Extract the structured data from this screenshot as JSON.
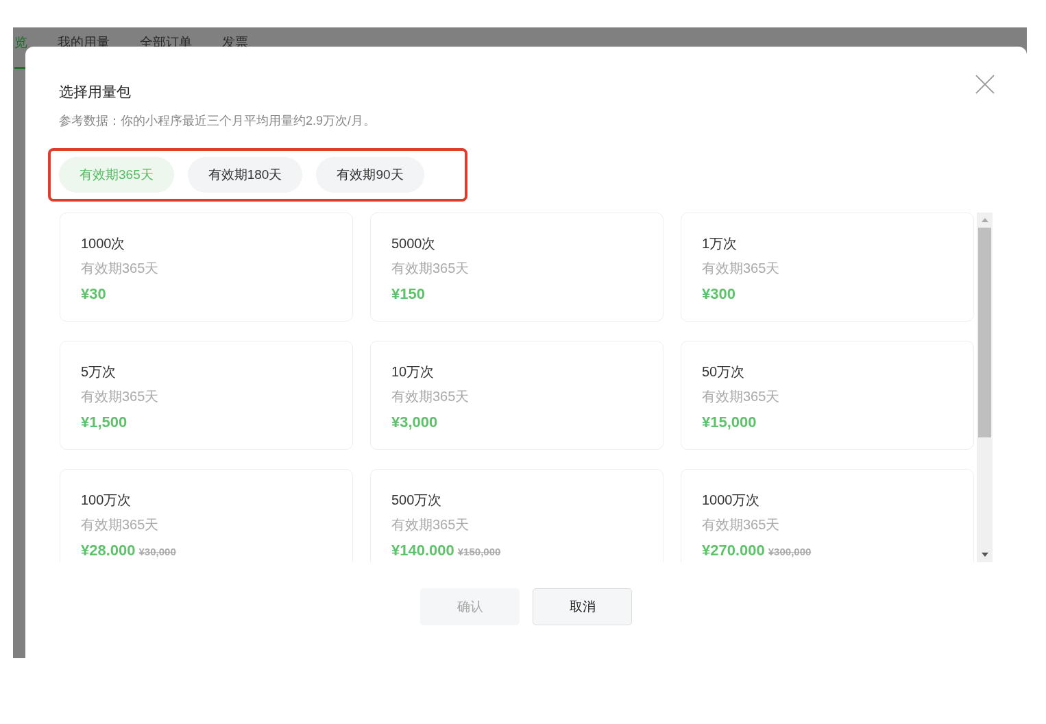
{
  "background_tabs": [
    {
      "label": "览",
      "selected": true
    },
    {
      "label": "我的用量",
      "selected": false
    },
    {
      "label": "全部订单",
      "selected": false
    },
    {
      "label": "发票",
      "selected": false
    }
  ],
  "dialog": {
    "title": "选择用量包",
    "subtitle": "参考数据：你的小程序最近三个月平均用量约2.9万次/月。",
    "period_options": [
      {
        "label": "有效期365天",
        "selected": true
      },
      {
        "label": "有效期180天",
        "selected": false
      },
      {
        "label": "有效期90天",
        "selected": false
      }
    ],
    "packages": [
      {
        "count": "1000次",
        "validity": "有效期365天",
        "price": "¥30"
      },
      {
        "count": "5000次",
        "validity": "有效期365天",
        "price": "¥150"
      },
      {
        "count": "1万次",
        "validity": "有效期365天",
        "price": "¥300"
      },
      {
        "count": "5万次",
        "validity": "有效期365天",
        "price": "¥1,500"
      },
      {
        "count": "10万次",
        "validity": "有效期365天",
        "price": "¥3,000"
      },
      {
        "count": "50万次",
        "validity": "有效期365天",
        "price": "¥15,000"
      },
      {
        "count": "100万次",
        "validity": "有效期365天",
        "price": "¥28.000",
        "original_price": "¥30,000"
      },
      {
        "count": "500万次",
        "validity": "有效期365天",
        "price": "¥140.000",
        "original_price": "¥150,000"
      },
      {
        "count": "1000万次",
        "validity": "有效期365天",
        "price": "¥270.000",
        "original_price": "¥300,000"
      }
    ],
    "buttons": [
      {
        "label": "确认",
        "disabled": true
      },
      {
        "label": "取消",
        "disabled": false
      }
    ]
  }
}
